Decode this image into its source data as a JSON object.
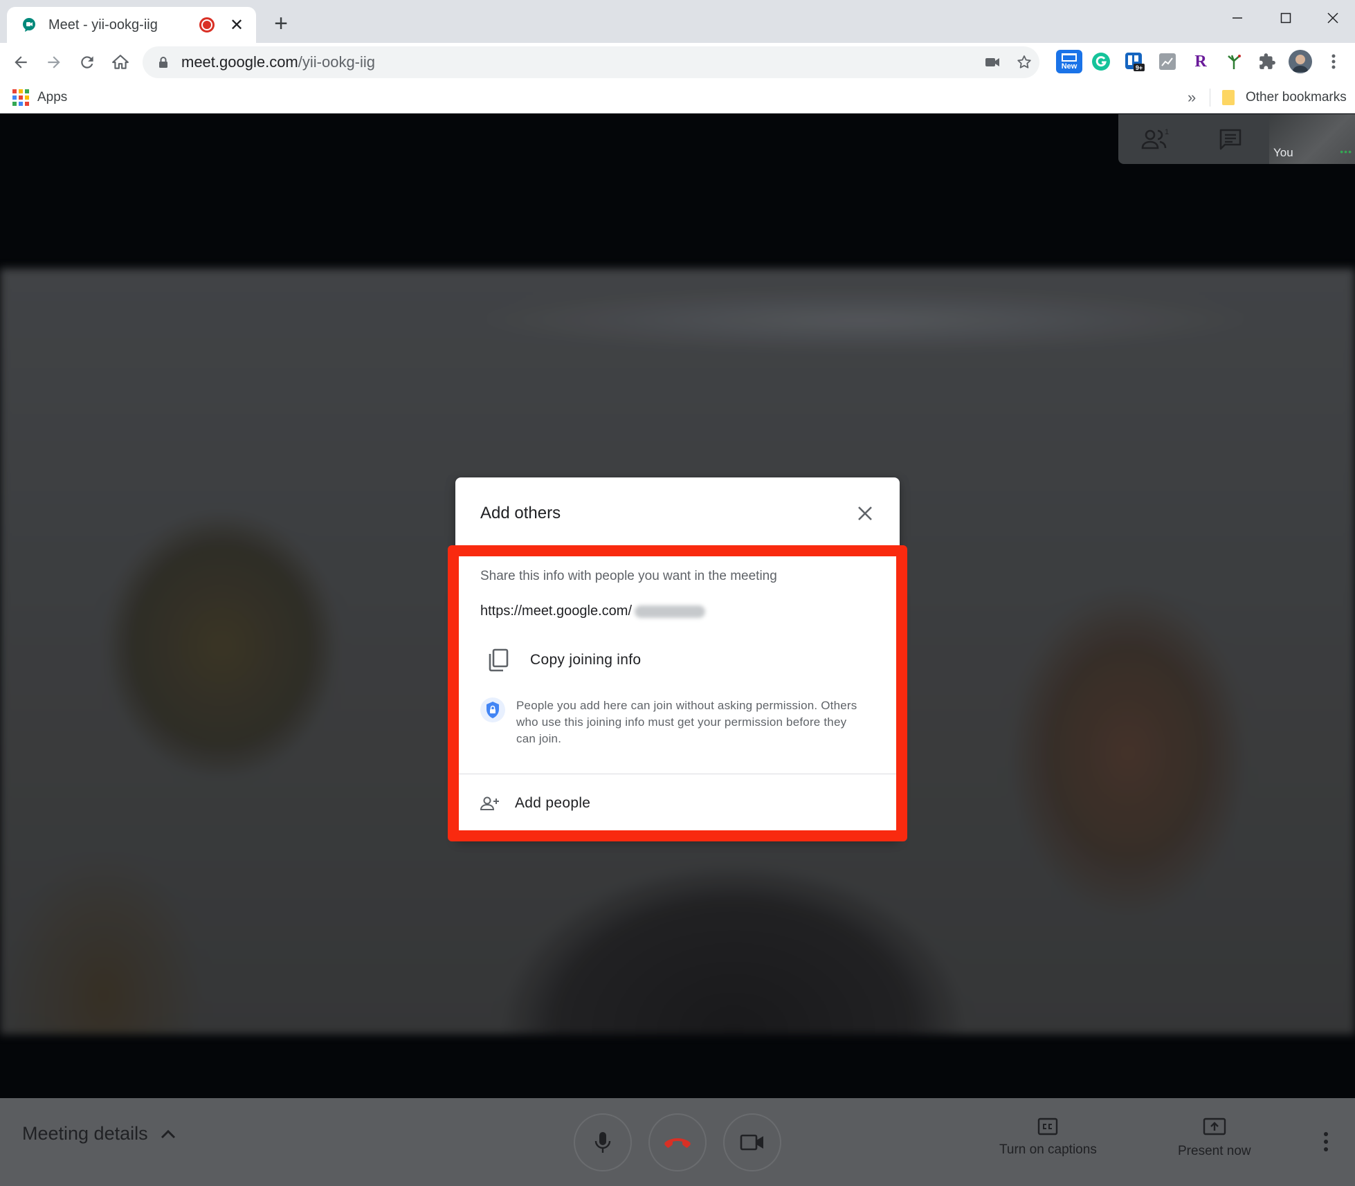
{
  "browser": {
    "tab_title": "Meet - yii-ookg-iig",
    "new_tab_label": "+",
    "url_host": "meet.google.com",
    "url_path": "/yii-ookg-iig",
    "extension_new_badge": "New",
    "extension_count_badge": "9+",
    "extension_r_label": "R"
  },
  "bookmarks": {
    "apps_label": "Apps",
    "more_label": "»",
    "other_label": "Other bookmarks"
  },
  "meet": {
    "participants_count": "1",
    "self_label": "You",
    "dialog": {
      "title": "Add others",
      "subtitle": "Share this info with people you want in the meeting",
      "url_prefix": "https://meet.google.com/",
      "copy_label": "Copy joining info",
      "permission_text": "People you add here can join without asking permission. Others who use this joining info must get your permission before they can join.",
      "add_people_label": "Add people"
    },
    "bottom_bar": {
      "meeting_details_label": "Meeting details",
      "captions_label": "Turn on captions",
      "present_label": "Present now"
    }
  },
  "colors": {
    "highlight": "#f92a0f",
    "shield_blue": "#4285f4",
    "hangup_red": "#d93025",
    "meet_green": "#00897b"
  }
}
